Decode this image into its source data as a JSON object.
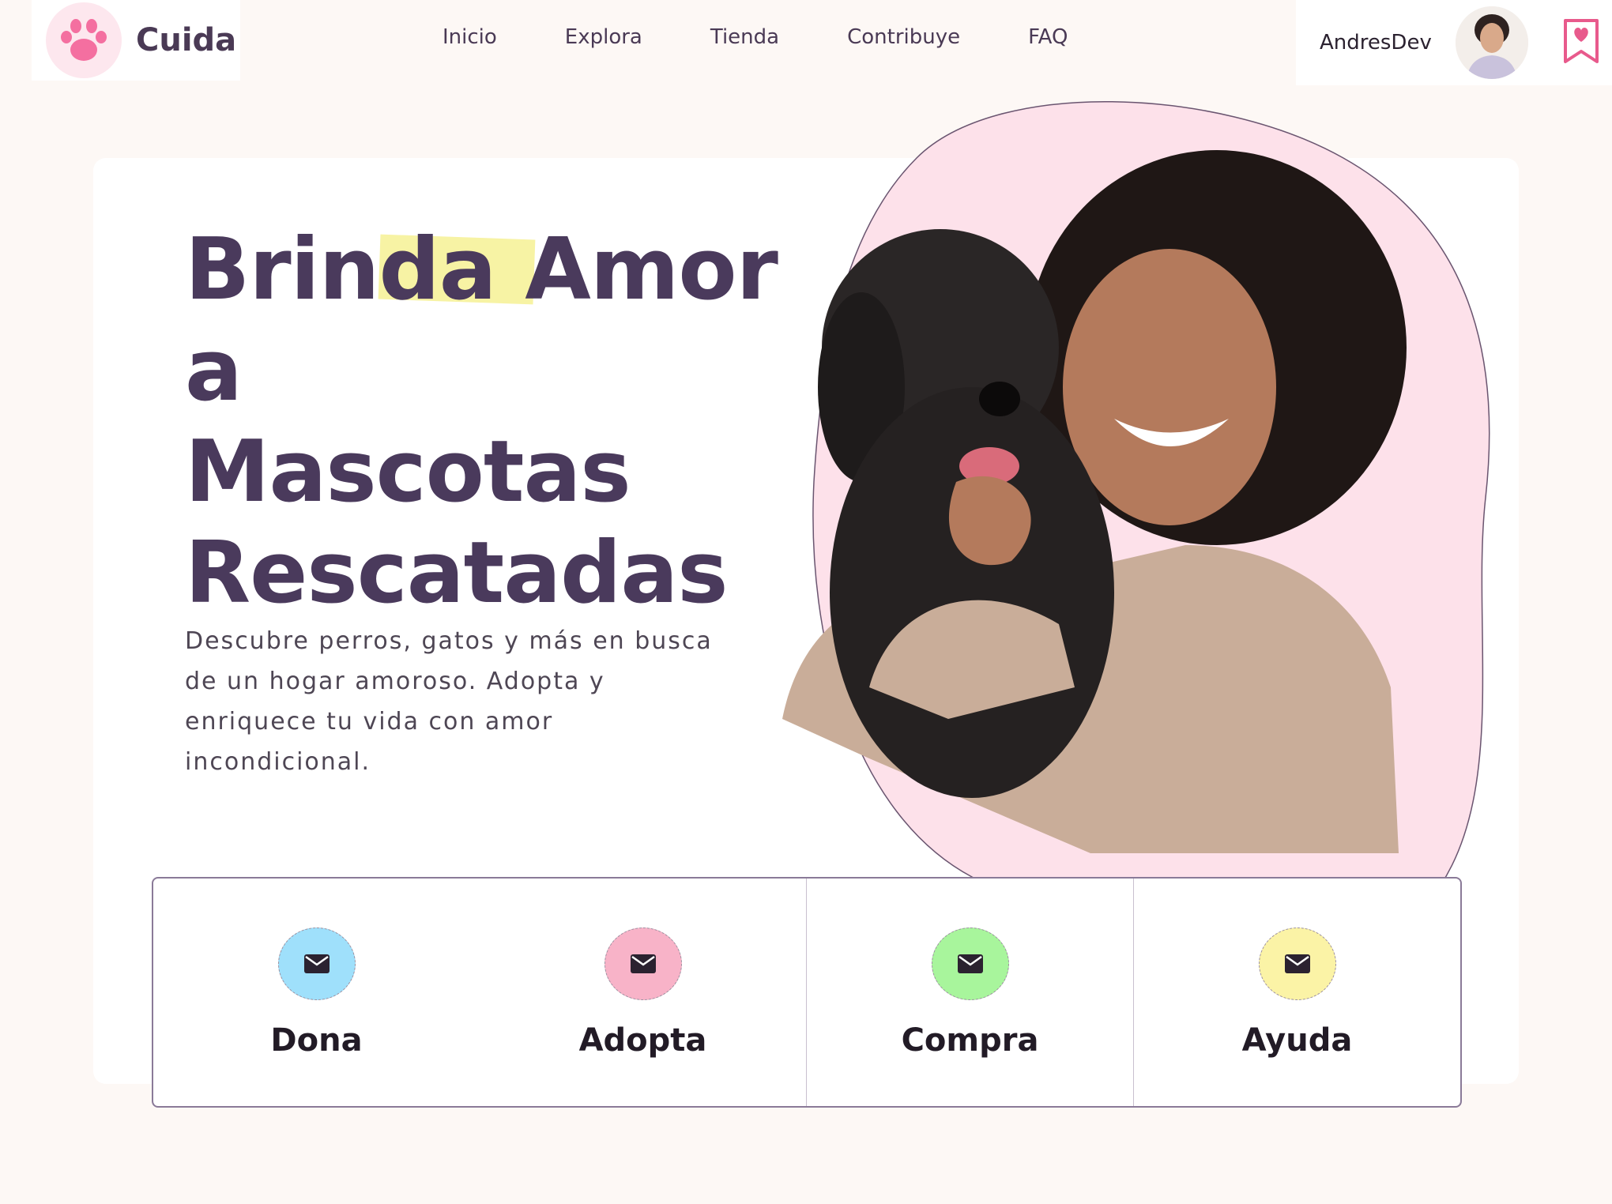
{
  "brand": {
    "name": "Cuida",
    "logo_icon": "paw-icon"
  },
  "nav": {
    "items": [
      {
        "label": "Inicio"
      },
      {
        "label": "Explora"
      },
      {
        "label": "Tienda"
      },
      {
        "label": "Contribuye"
      },
      {
        "label": "FAQ"
      }
    ]
  },
  "user": {
    "name": "AndresDev",
    "avatar_icon": "avatar-icon",
    "bookmark_icon": "heart-bookmark-icon"
  },
  "hero": {
    "title_line1": "Brinda Amor a",
    "title_line2": "Mascotas",
    "title_line3": "Rescatadas",
    "description": "Descubre perros, gatos y más en busca de un hogar amoroso. Adopta y enriquece tu vida con amor incondicional."
  },
  "actions": [
    {
      "label": "Dona",
      "icon": "envelope-icon",
      "color": "#9fe0fb"
    },
    {
      "label": "Adopta",
      "icon": "envelope-icon",
      "color": "#f8b3c8"
    },
    {
      "label": "Compra",
      "icon": "envelope-icon",
      "color": "#a8f59c"
    },
    {
      "label": "Ayuda",
      "icon": "envelope-icon",
      "color": "#fbf3a6"
    }
  ],
  "colors": {
    "accent": "#f46fa0",
    "title": "#4a3a5c",
    "blob": "#fde1ea",
    "highlight": "#f7f3a4"
  }
}
